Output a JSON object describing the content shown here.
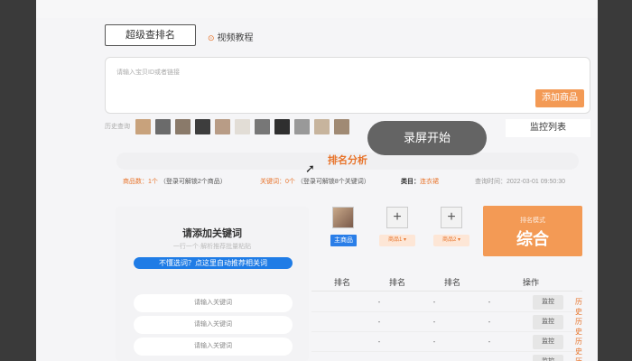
{
  "top": {
    "super_rank_button": "超级查排名",
    "video_tutorial": "视频教程",
    "video_icon": "play-circle-icon"
  },
  "input": {
    "placeholder": "请输入宝贝ID或者链接",
    "add_button": "添加商品"
  },
  "history": {
    "label": "历史查询",
    "thumbs": [
      "#c8a27c",
      "#6b6b6b",
      "#8a7a6a",
      "#3d3d3d",
      "#b89c86",
      "#e2ddd6",
      "#777777",
      "#2f2f2f",
      "#999999",
      "#c7b49d",
      "#a08a74"
    ]
  },
  "monitor_list_button": "监控列表",
  "recording": {
    "label": "录屏开始"
  },
  "analysis": {
    "title": "排名分析",
    "products_label": "商品数：",
    "products_value": "1个",
    "products_hint": "（登录可解锁2个商品）",
    "keywords_label": "关键词：",
    "keywords_value": "0个",
    "keywords_hint": "（登录可解锁8个关键词）",
    "category_label": "类目：",
    "category_value": "连衣裙",
    "query_time_label": "查询时间：",
    "query_time_value": "2022-03-01 09:50:30"
  },
  "keyword_panel": {
    "title": "请添加关键词",
    "subtitle": "一行一个·解析推荐批量粘贴",
    "recommend_button": "不懂选词？点这里自动推荐相关词",
    "inputs": [
      "请输入关键词",
      "请输入关键词",
      "请输入关键词"
    ]
  },
  "products": {
    "main_badge": "主商品",
    "p1_badge": "商品1 ▾",
    "p2_badge": "商品2 ▾",
    "add_icon": "plus-icon"
  },
  "rank_mode": {
    "label": "排名模式",
    "value": "综合"
  },
  "table": {
    "headers": [
      "排名",
      "排名",
      "排名",
      "操作"
    ],
    "rows": [
      {
        "c1": "-",
        "c2": "-",
        "c3": "-",
        "monitor": "监控",
        "history": "历史"
      },
      {
        "c1": "-",
        "c2": "-",
        "c3": "-",
        "monitor": "监控",
        "history": "历史"
      },
      {
        "c1": "-",
        "c2": "-",
        "c3": "-",
        "monitor": "监控",
        "history": "历史"
      },
      {
        "c1": "-",
        "c2": "-",
        "c3": "-",
        "monitor": "监控",
        "history": "历史"
      }
    ]
  }
}
